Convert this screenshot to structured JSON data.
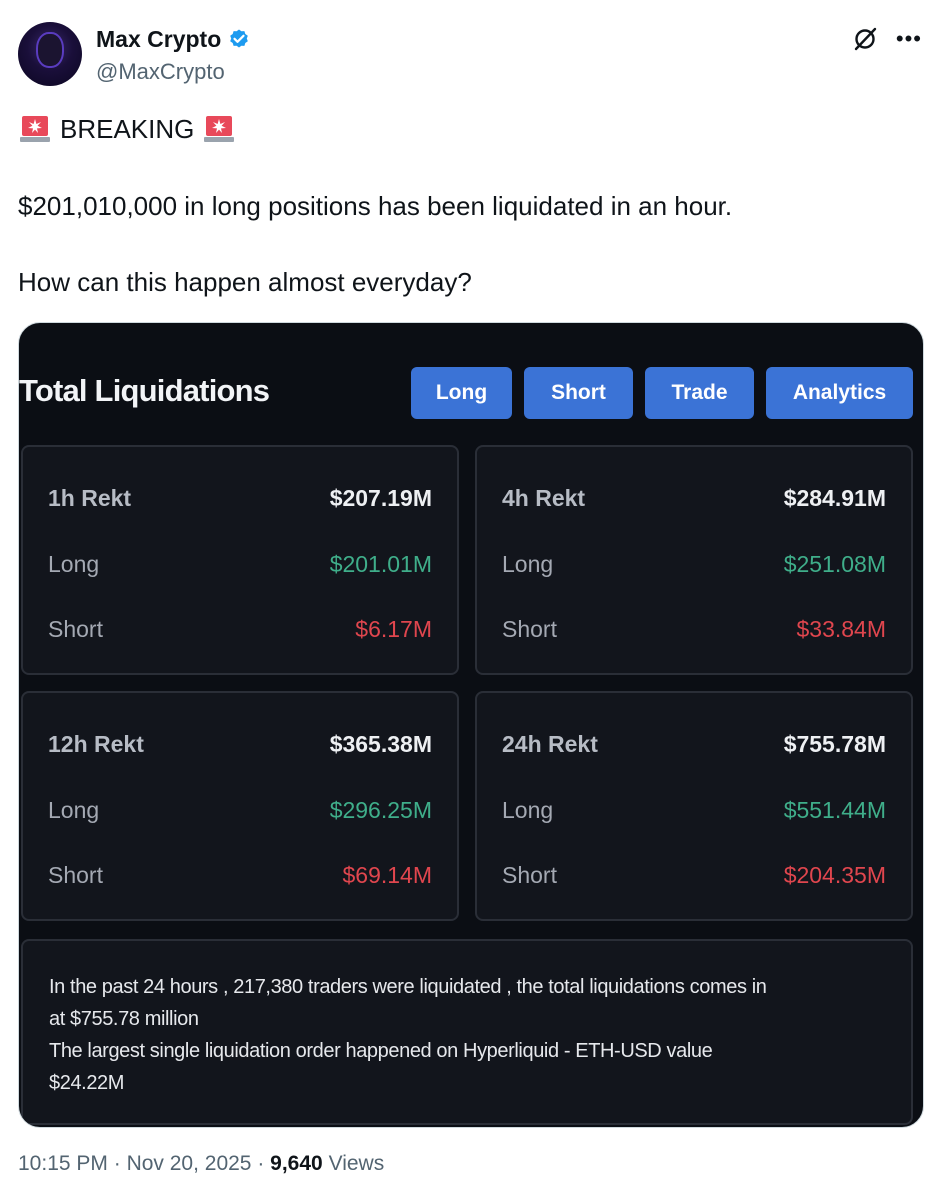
{
  "author": {
    "display_name": "Max Crypto",
    "handle": "@MaxCrypto"
  },
  "tweet": {
    "breaking": "BREAKING",
    "line_main": "$201,010,000 in long positions has been liquidated in an hour.",
    "line_question": "How can this happen almost everyday?"
  },
  "card": {
    "title": "Total Liquidations",
    "buttons": [
      "Long",
      "Short",
      "Trade",
      "Analytics"
    ],
    "boxes": [
      {
        "period": "1h Rekt",
        "total": "$207.19M",
        "long_label": "Long",
        "long": "$201.01M",
        "short_label": "Short",
        "short": "$6.17M"
      },
      {
        "period": "4h Rekt",
        "total": "$284.91M",
        "long_label": "Long",
        "long": "$251.08M",
        "short_label": "Short",
        "short": "$33.84M"
      },
      {
        "period": "12h Rekt",
        "total": "$365.38M",
        "long_label": "Long",
        "long": "$296.25M",
        "short_label": "Short",
        "short": "$69.14M"
      },
      {
        "period": "24h Rekt",
        "total": "$755.78M",
        "long_label": "Long",
        "long": "$551.44M",
        "short_label": "Short",
        "short": "$204.35M"
      }
    ],
    "summary_lines": [
      "In the past 24 hours , 217,380 traders were liquidated , the total liquidations comes in",
      "at $755.78 million",
      "The largest single liquidation order happened on Hyperliquid - ETH-USD value",
      "$24.22M"
    ]
  },
  "meta": {
    "time": "10:15 PM",
    "sep1": " · ",
    "date": "Nov 20, 2025",
    "sep2": " · ",
    "views_count": "9,640",
    "views_label": " Views"
  },
  "colors": {
    "card_bg": "#0b0e14",
    "button_blue": "#3b73d6",
    "long_green": "#3fae8a",
    "short_red": "#e0464e",
    "verified_blue": "#1d9bf0"
  },
  "icons": [
    "verified-badge-icon",
    "grok-icon",
    "more-options-icon",
    "siren-emoji-icon"
  ]
}
